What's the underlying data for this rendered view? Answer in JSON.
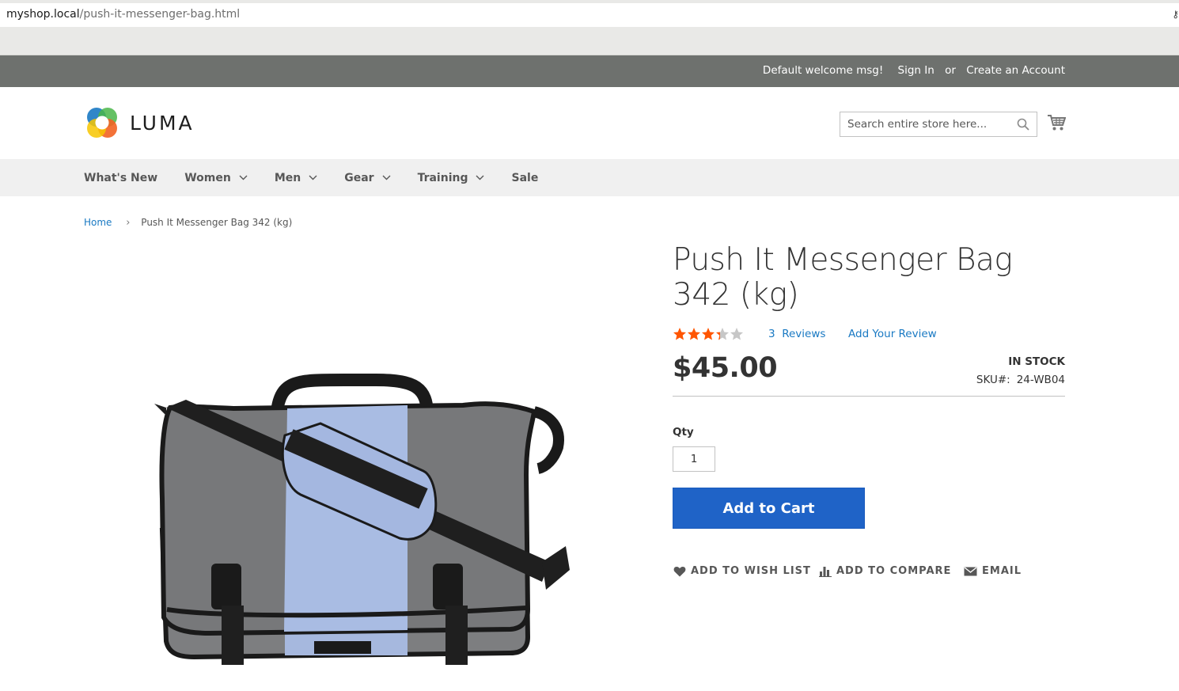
{
  "browser": {
    "url_host": "myshop.local",
    "url_path": "/push-it-messenger-bag.html"
  },
  "panel": {
    "welcome": "Default welcome msg!",
    "sign_in": "Sign In",
    "or": "or",
    "create_account": "Create an Account"
  },
  "header": {
    "logo_text": "LUMA",
    "search_placeholder": "Search entire store here...",
    "search_icon": "search-icon",
    "cart_icon": "cart-icon"
  },
  "nav": {
    "items": [
      {
        "label": "What's New",
        "has_dropdown": false
      },
      {
        "label": "Women",
        "has_dropdown": true
      },
      {
        "label": "Men",
        "has_dropdown": true
      },
      {
        "label": "Gear",
        "has_dropdown": true
      },
      {
        "label": "Training",
        "has_dropdown": true
      },
      {
        "label": "Sale",
        "has_dropdown": false
      }
    ]
  },
  "breadcrumb": {
    "home": "Home",
    "separator": "›",
    "current": "Push It Messenger Bag  342 (kg)"
  },
  "product": {
    "title": "Push It Messenger Bag 342 (kg)",
    "rating_stars": 3.3,
    "rating_max": 5,
    "reviews_count": "3",
    "reviews_label": "Reviews",
    "add_review": "Add Your Review",
    "price": "$45.00",
    "stock": "IN STOCK",
    "sku_label": "SKU#:",
    "sku_value": "24-WB04",
    "qty_label": "Qty",
    "qty_value": "1",
    "add_to_cart": "Add to Cart",
    "actions": {
      "wish_list": "ADD TO WISH LIST",
      "compare": "ADD TO COMPARE",
      "email": "EMAIL"
    }
  },
  "colors": {
    "panel_bg": "#6e716e",
    "nav_bg": "#f0f0f0",
    "link": "#1979c3",
    "primary_button": "#1f63c7",
    "star_filled": "#ff5501",
    "star_empty": "#c7c7c7"
  }
}
